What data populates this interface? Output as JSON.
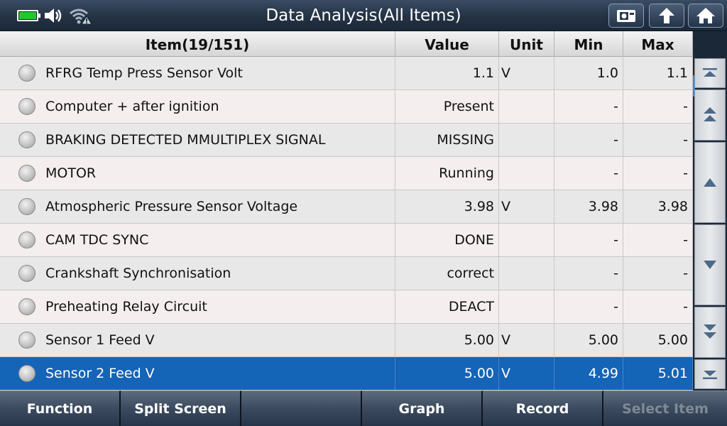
{
  "header": {
    "title": "Data Analysis(All Items)"
  },
  "table": {
    "columns": {
      "item": "Item(19/151)",
      "value": "Value",
      "unit": "Unit",
      "min": "Min",
      "max": "Max"
    },
    "rows": [
      {
        "name": "RFRG Temp Press Sensor Volt",
        "value": "1.1",
        "unit": "V",
        "min": "1.0",
        "max": "1.1"
      },
      {
        "name": "Computer + after ignition",
        "value": "Present",
        "unit": "",
        "min": "-",
        "max": "-"
      },
      {
        "name": "BRAKING DETECTED MMULTIPLEX SIGNAL",
        "value": "MISSING",
        "unit": "",
        "min": "-",
        "max": "-"
      },
      {
        "name": "MOTOR",
        "value": "Running",
        "unit": "",
        "min": "-",
        "max": "-"
      },
      {
        "name": "Atmospheric Pressure Sensor Voltage",
        "value": "3.98",
        "unit": "V",
        "min": "3.98",
        "max": "3.98"
      },
      {
        "name": "CAM TDC SYNC",
        "value": "DONE",
        "unit": "",
        "min": "-",
        "max": "-"
      },
      {
        "name": "Crankshaft Synchronisation",
        "value": "correct",
        "unit": "",
        "min": "-",
        "max": "-"
      },
      {
        "name": "Preheating Relay Circuit",
        "value": "DEACT",
        "unit": "",
        "min": "-",
        "max": "-"
      },
      {
        "name": "Sensor 1 Feed V",
        "value": "5.00",
        "unit": "V",
        "min": "5.00",
        "max": "5.00"
      },
      {
        "name": "Sensor 2 Feed V",
        "value": "5.00",
        "unit": "V",
        "min": "4.99",
        "max": "5.01"
      }
    ],
    "selected_row": 9
  },
  "bottom_bar": {
    "function": "Function",
    "split_screen": "Split Screen",
    "empty": "",
    "graph": "Graph",
    "record": "Record",
    "select_item": "Select Item"
  },
  "icons": {
    "battery": "battery-charging-icon",
    "volume": "speaker-icon",
    "wifi": "wifi-warning-icon",
    "top_buttons": [
      "screenshot-icon",
      "back-icon",
      "home-icon"
    ],
    "scroll_buttons": [
      "scroll-top-icon",
      "page-up-icon",
      "line-up-icon",
      "line-down-icon",
      "page-down-icon",
      "scroll-bottom-icon"
    ]
  },
  "colors": {
    "selected_row": "#1464b8",
    "battery_fill": "#22c832",
    "scroll_indicator": "#1e8ff0"
  }
}
